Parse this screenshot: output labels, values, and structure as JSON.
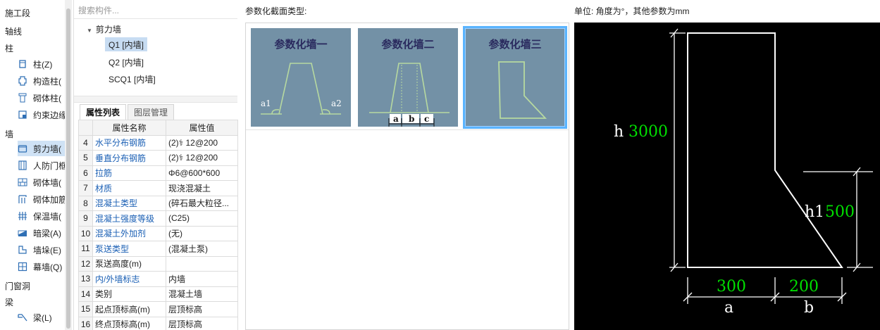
{
  "nav": {
    "categories": {
      "construction_stage": "施工段",
      "axis": "轴线",
      "column": "柱",
      "wall": "墙",
      "door_window": "门窗洞",
      "beam": "梁"
    },
    "items": [
      {
        "label": "柱(Z)",
        "icon": "column-icon"
      },
      {
        "label": "构造柱(",
        "icon": "structural-column-icon"
      },
      {
        "label": "砌体柱(",
        "icon": "masonry-column-icon"
      },
      {
        "label": "约束边缘",
        "icon": "boundary-element-icon"
      },
      {
        "label": "剪力墙(",
        "icon": "shear-wall-icon"
      },
      {
        "label": "人防门框",
        "icon": "civil-defense-door-icon"
      },
      {
        "label": "砌体墙(",
        "icon": "masonry-wall-icon"
      },
      {
        "label": "砌体加筋",
        "icon": "masonry-reinforcement-icon"
      },
      {
        "label": "保温墙(",
        "icon": "insulation-wall-icon"
      },
      {
        "label": "暗梁(A)",
        "icon": "concealed-beam-icon"
      },
      {
        "label": "墙垛(E)",
        "icon": "wall-pier-icon"
      },
      {
        "label": "幕墙(Q)",
        "icon": "curtain-wall-icon"
      },
      {
        "label": "梁(L)",
        "icon": "beam-icon"
      }
    ]
  },
  "component_tree": {
    "search_placeholder": "搜索构件...",
    "group": "剪力墙",
    "items": [
      "Q1 [内墙]",
      "Q2 [内墙]",
      "SCQ1 [内墙]"
    ]
  },
  "tabs": [
    "属性列表",
    "图层管理"
  ],
  "properties": {
    "headers": [
      "属性名称",
      "属性值"
    ],
    "rows": [
      {
        "no": "4",
        "name": "水平分布钢筋",
        "value": "(2)⚕ 12@200"
      },
      {
        "no": "5",
        "name": "垂直分布钢筋",
        "value": "(2)⚕ 12@200"
      },
      {
        "no": "6",
        "name": "拉筋",
        "value": "Φ6@600*600"
      },
      {
        "no": "7",
        "name": "材质",
        "value": "现浇混凝土"
      },
      {
        "no": "8",
        "name": "混凝土类型",
        "value": "(碎石最大粒径..."
      },
      {
        "no": "9",
        "name": "混凝土强度等级",
        "value": "(C25)"
      },
      {
        "no": "10",
        "name": "混凝土外加剂",
        "value": "(无)"
      },
      {
        "no": "11",
        "name": "泵送类型",
        "value": "(混凝土泵)"
      },
      {
        "no": "12",
        "name": "泵送高度(m)",
        "value": ""
      },
      {
        "no": "13",
        "name": "内/外墙标志",
        "value": "内墙"
      },
      {
        "no": "14",
        "name": "类别",
        "value": "混凝土墙"
      },
      {
        "no": "15",
        "name": "起点顶标高(m)",
        "value": "层顶标高"
      },
      {
        "no": "16",
        "name": "终点顶标高(m)",
        "value": "层顶标高"
      }
    ]
  },
  "dialog": {
    "section_label": "参数化截面类型:",
    "units_label": "单位:  角度为°，其他参数为mm",
    "cards": [
      {
        "title": "参数化墙一",
        "labels": [
          "a1",
          "a2"
        ]
      },
      {
        "title": "参数化墙二",
        "labels": [
          "a",
          "b",
          "c"
        ]
      },
      {
        "title": "参数化墙三",
        "labels": []
      }
    ],
    "selected_card": 2
  },
  "preview": {
    "h_label": "h",
    "h_value": "3000",
    "h1_label": "h1",
    "h1_value": "500",
    "a_label": "a",
    "a_value": "300",
    "b_label": "b",
    "b_value": "200",
    "colors": {
      "line": "#ffffff",
      "value": "#00e000",
      "background": "#000000"
    }
  }
}
